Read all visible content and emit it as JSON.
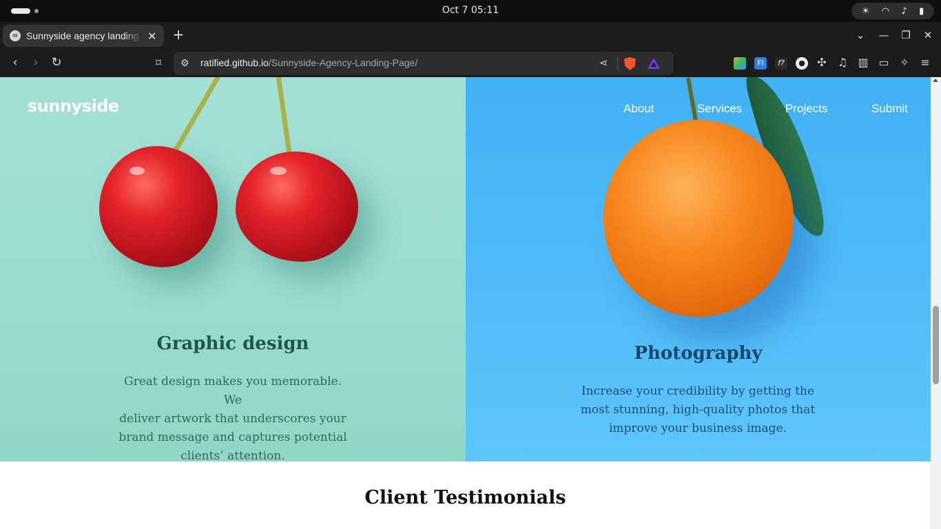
{
  "os": {
    "clock": "Oct 7  05:11"
  },
  "browser": {
    "tab_title": "Sunnyside agency landing page",
    "url_host": "ratified.github.io",
    "url_path": "/Sunnyside-Agency-Landing-Page/"
  },
  "site": {
    "logo": "sunnyside",
    "nav": [
      "About",
      "Services",
      "Projects",
      "Submit"
    ]
  },
  "services": [
    {
      "title": "Graphic design",
      "lines": [
        "Great design makes you memorable. We",
        "deliver artwork that underscores your",
        "brand message and captures potential",
        "clients’ attention."
      ]
    },
    {
      "title": "Photography",
      "lines": [
        "Increase your credibility by getting the",
        "most stunning, high-quality photos that",
        "improve your business image."
      ]
    }
  ],
  "testimonials_heading": "Client Testimonials",
  "colors": {
    "graphic_panel": "#9addd0",
    "photo_panel": "#4fbaf7",
    "graphic_title": "#1d5748",
    "photo_title": "#16476b"
  }
}
